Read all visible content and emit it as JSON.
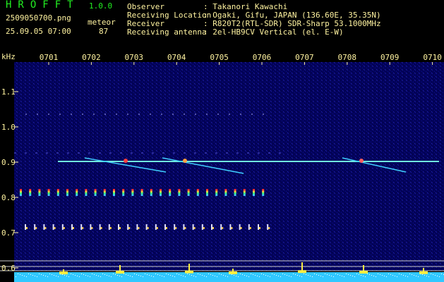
{
  "app": {
    "title": "HROFFT",
    "version": "1.0.0"
  },
  "file": {
    "name": "2509050700.png",
    "datetime": "25.09.05 07:00"
  },
  "meteor": {
    "label": "meteor",
    "count": "87"
  },
  "info": [
    {
      "label": "Observer",
      "value": ": Takanori Kawachi"
    },
    {
      "label": "Receiving Location",
      "value": ": Ogaki, Gifu, JAPAN (136.60E, 35.35N)"
    },
    {
      "label": "Receiver",
      "value": ": R820T2(RTL-SDR) SDR-Sharp 53.1000MHz"
    },
    {
      "label": "Receiving antenna",
      "value": ": 2el-HB9CV Vertical (el. E-W)"
    }
  ],
  "spectrogram": {
    "y_unit": "kHz",
    "time_labels": [
      "0701",
      "0702",
      "0703",
      "0704",
      "0705",
      "0706",
      "0707",
      "0708",
      "0709",
      "0710"
    ],
    "freq_labels": [
      "1.1",
      "1.0",
      "0.9",
      "0.8",
      "0.7",
      "0.6"
    ]
  }
}
